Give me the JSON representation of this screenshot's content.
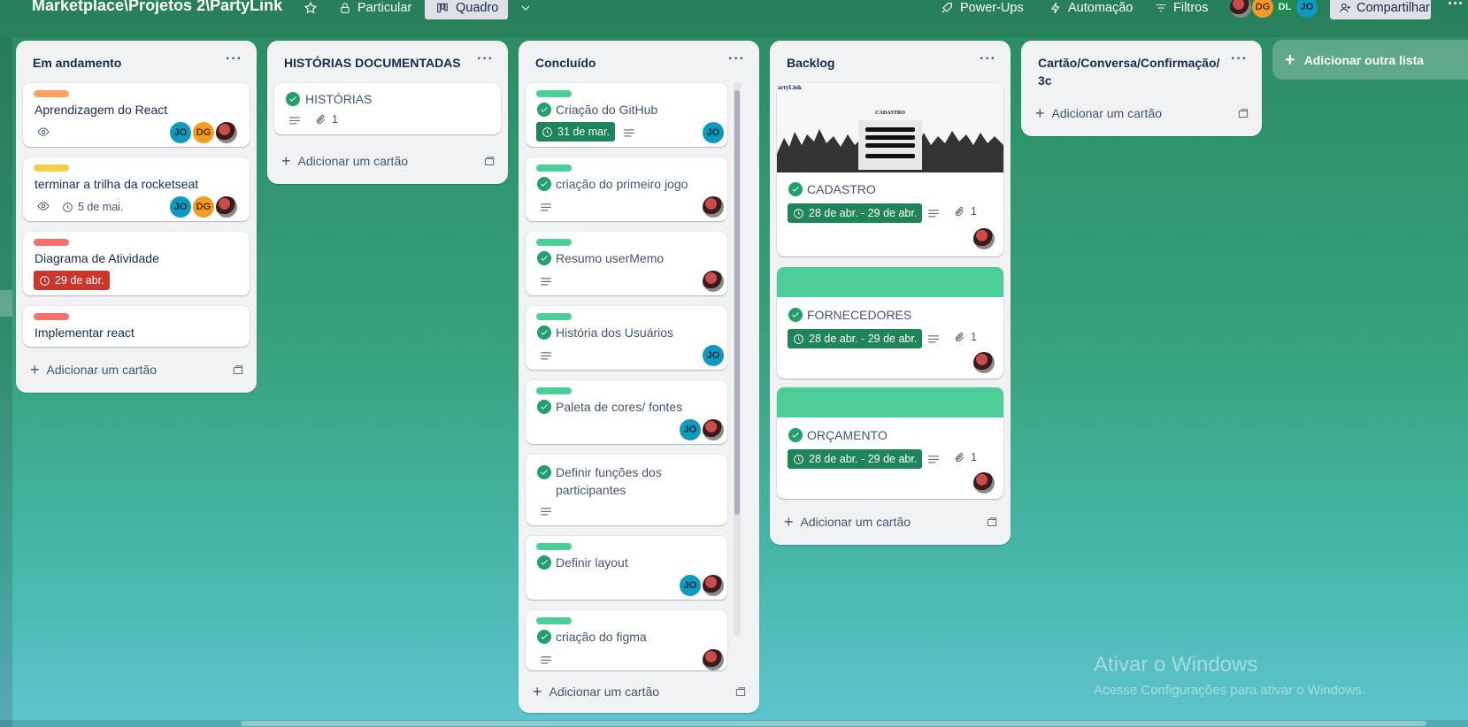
{
  "header": {
    "board_title": "Marketplace\\Projetos 2\\PartyLink",
    "visibility_label": "Particular",
    "view_label": "Quadro",
    "powerups_label": "Power-Ups",
    "automation_label": "Automação",
    "filters_label": "Filtros",
    "share_label": "Compartilhar",
    "members": [
      "DG",
      "DL",
      "JO"
    ]
  },
  "lists": [
    {
      "title": "Em andamento",
      "add_card_label": "Adicionar um cartão",
      "cards": [
        {
          "title": "Aprendizagem do React",
          "label_color": "#fea362",
          "members": [
            "JO",
            "DG"
          ]
        },
        {
          "title": "terminar a trilha da rocketseat",
          "label_color": "#f5cd47",
          "date": "5 de mai.",
          "members": [
            "JO",
            "DG"
          ]
        },
        {
          "title": "Diagrama de Atividade",
          "label_color": "#f87168",
          "date": "29 de abr."
        },
        {
          "title": "Implementar react",
          "label_color": "#f87168"
        }
      ]
    },
    {
      "title": "HISTÓRIAS DOCUMENTADAS",
      "add_card_label": "Adicionar um cartão",
      "cards": [
        {
          "title": "HISTÓRIAS",
          "attachments": "1"
        }
      ]
    },
    {
      "title": "Concluído",
      "add_card_label": "Adicionar um cartão",
      "cards": [
        {
          "title": "Criação do GitHub",
          "date": "31 de mar.",
          "members": [
            "JO"
          ]
        },
        {
          "title": "criação do primeiro jogo"
        },
        {
          "title": "Resumo userMemo"
        },
        {
          "title": "História dos Usuários",
          "members": [
            "JO"
          ]
        },
        {
          "title": "Paleta de cores/ fontes",
          "members": [
            "JO"
          ]
        },
        {
          "title": "Definir funções dos participantes"
        },
        {
          "title": "Definir layout",
          "members": [
            "JO"
          ]
        },
        {
          "title": "criação do figma"
        }
      ]
    },
    {
      "title": "Backlog",
      "add_card_label": "Adicionar um cartão",
      "cards": [
        {
          "title": "CADASTRO",
          "date": "28 de abr. - 29 de abr.",
          "attachments": "1",
          "cover_brand": "artyLink",
          "cover_heading": "CADASTRO"
        },
        {
          "title": "FORNECEDORES",
          "date": "28 de abr. - 29 de abr.",
          "attachments": "1"
        },
        {
          "title": "ORÇAMENTO",
          "date": "28 de abr. - 29 de abr.",
          "attachments": "1"
        }
      ]
    },
    {
      "title": "Cartão/Conversa/Confirmação/ 3c",
      "add_card_label": "Adicionar um cartão",
      "cards": []
    }
  ],
  "add_list_label": "Adicionar outra lista",
  "watermark": {
    "title": "Ativar o Windows",
    "subtitle": "Acesse Configurações para ativar o Windows."
  },
  "colors": {
    "label_green": "#4bce97",
    "date_green": "#1f845a",
    "date_red": "#c9372c",
    "check_green": "#22a06b"
  }
}
